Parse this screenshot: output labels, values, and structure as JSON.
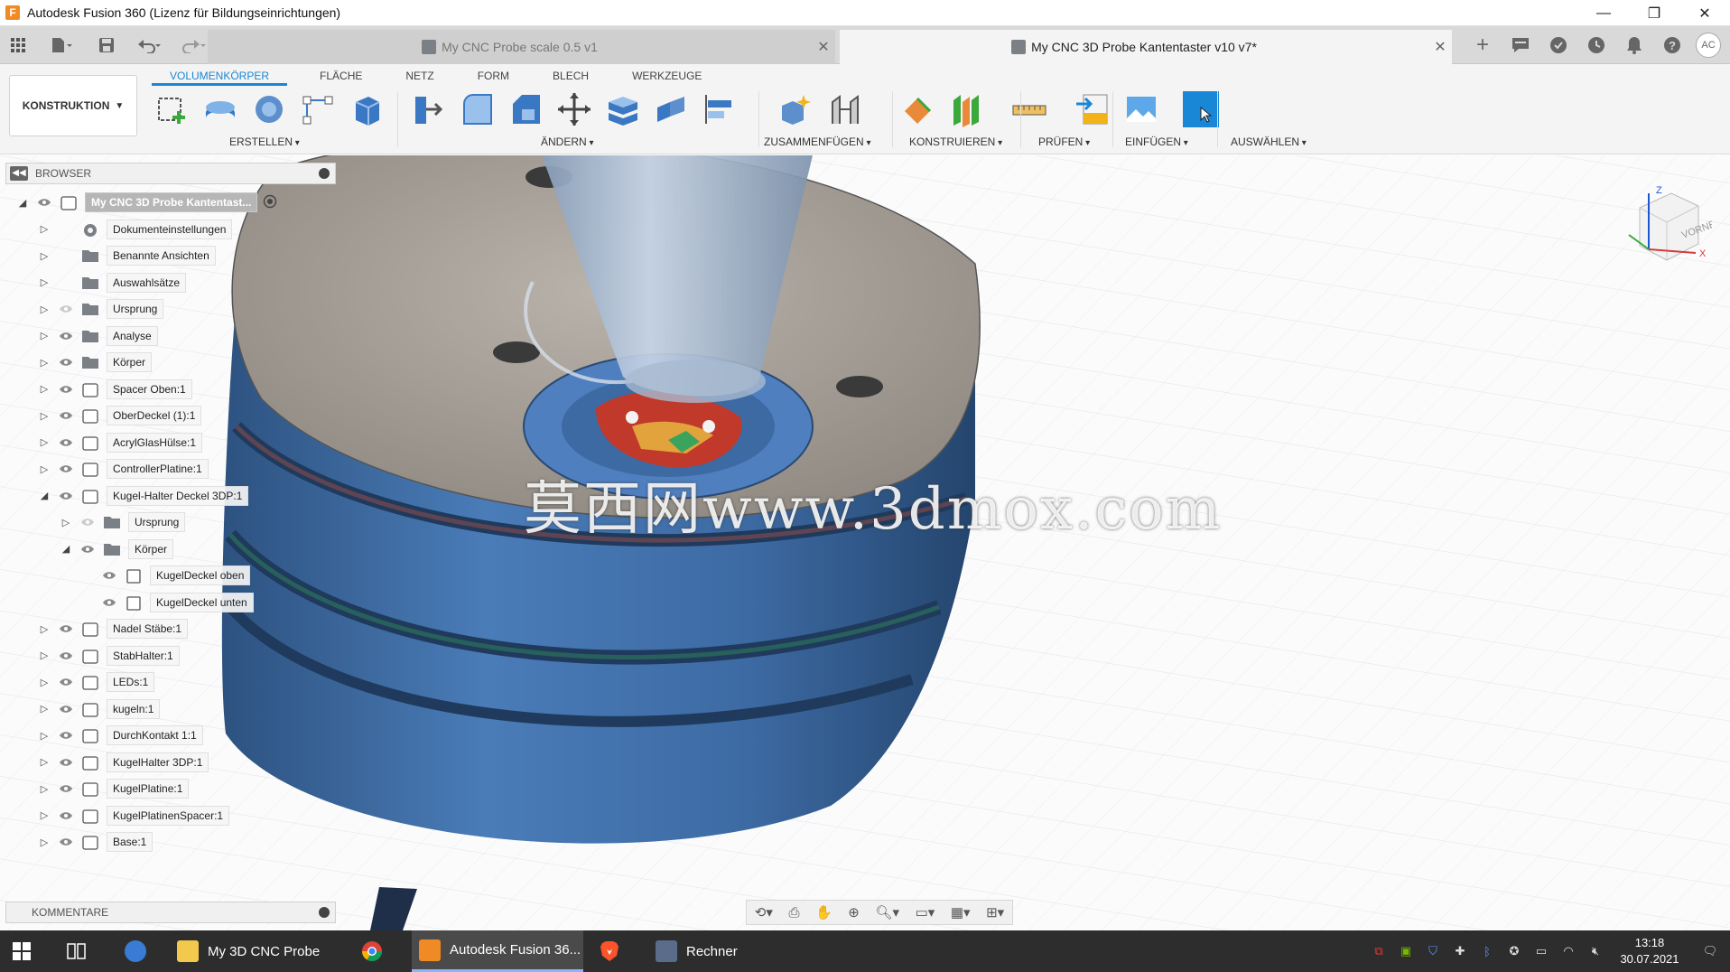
{
  "window": {
    "title": "Autodesk Fusion 360 (Lizenz für Bildungseinrichtungen)",
    "minimize": "—",
    "maximize": "❐",
    "close": "✕"
  },
  "tabs": [
    {
      "label": "My CNC Probe scale 0.5 v1",
      "close": "✕"
    },
    {
      "label": "My CNC 3D Probe Kantentaster v10 v7*",
      "close": "✕"
    }
  ],
  "header_icons": {
    "add": "+",
    "avatar": "AC"
  },
  "ribbon": {
    "workspace": "KONSTRUKTION",
    "tabs": [
      "VOLUMENKÖRPER",
      "FLÄCHE",
      "NETZ",
      "FORM",
      "BLECH",
      "WERKZEUGE"
    ],
    "groups": [
      "ERSTELLEN",
      "ÄNDERN",
      "ZUSAMMENFÜGEN",
      "KONSTRUIEREN",
      "PRÜFEN",
      "EINFÜGEN",
      "AUSWÄHLEN"
    ]
  },
  "browser": {
    "title": "BROWSER",
    "items": [
      {
        "label": "My CNC 3D Probe Kantentast...",
        "expanded": true,
        "type": "root",
        "icon": "component-icon"
      },
      {
        "label": "Dokumenteinstellungen",
        "expanded": false,
        "type": "settings",
        "icon": "gear-icon"
      },
      {
        "label": "Benannte Ansichten",
        "expanded": false,
        "type": "folder",
        "icon": "folder-icon"
      },
      {
        "label": "Auswahlsätze",
        "expanded": false,
        "type": "folder",
        "icon": "folder-icon"
      },
      {
        "label": "Ursprung",
        "expanded": false,
        "type": "folder",
        "icon": "folder-icon"
      },
      {
        "label": "Analyse",
        "expanded": false,
        "type": "folder",
        "icon": "folder-icon"
      },
      {
        "label": "Körper",
        "expanded": false,
        "type": "folder",
        "icon": "folder-icon"
      },
      {
        "label": "Spacer Oben:1",
        "expanded": false,
        "type": "component",
        "icon": "component-icon"
      },
      {
        "label": "OberDeckel (1):1",
        "expanded": false,
        "type": "component",
        "icon": "component-icon"
      },
      {
        "label": "AcrylGlasHülse:1",
        "expanded": false,
        "type": "component",
        "icon": "component-icon"
      },
      {
        "label": "ControllerPlatine:1",
        "expanded": false,
        "type": "component",
        "icon": "component-icon"
      },
      {
        "label": "Kugel-Halter Deckel 3DP:1",
        "expanded": true,
        "type": "component",
        "icon": "component-icon"
      },
      {
        "label": "Ursprung",
        "expanded": false,
        "type": "folder",
        "icon": "folder-icon"
      },
      {
        "label": "Körper",
        "expanded": true,
        "type": "folder",
        "icon": "folder-icon"
      },
      {
        "label": "KugelDeckel oben",
        "expanded": null,
        "type": "body",
        "icon": "body-icon"
      },
      {
        "label": "KugelDeckel unten",
        "expanded": null,
        "type": "body",
        "icon": "body-icon"
      },
      {
        "label": "Nadel Stäbe:1",
        "expanded": false,
        "type": "component",
        "icon": "component-icon"
      },
      {
        "label": "StabHalter:1",
        "expanded": false,
        "type": "component",
        "icon": "component-icon"
      },
      {
        "label": "LEDs:1",
        "expanded": false,
        "type": "component",
        "icon": "component-icon"
      },
      {
        "label": "kugeln:1",
        "expanded": false,
        "type": "component",
        "icon": "component-icon"
      },
      {
        "label": "DurchKontakt 1:1",
        "expanded": false,
        "type": "component",
        "icon": "component-icon"
      },
      {
        "label": "KugelHalter 3DP:1",
        "expanded": false,
        "type": "component",
        "icon": "component-icon"
      },
      {
        "label": "KugelPlatine:1",
        "expanded": false,
        "type": "component",
        "icon": "component-icon"
      },
      {
        "label": "KugelPlatinenSpacer:1",
        "expanded": false,
        "type": "component",
        "icon": "component-icon"
      },
      {
        "label": "Base:1",
        "expanded": false,
        "type": "component",
        "icon": "component-icon"
      }
    ]
  },
  "comments": {
    "title": "KOMMENTARE"
  },
  "viewcube": {
    "face": "VORNE",
    "axis_z": "Z",
    "axis_x": "X"
  },
  "watermark": "莫西网www.3dmox.com",
  "taskbar": {
    "items": [
      {
        "label": "My 3D CNC Probe",
        "icon": "folder-icon"
      },
      {
        "label": "Autodesk Fusion 36...",
        "icon": "fusion-icon"
      },
      {
        "label": "Rechner",
        "icon": "calculator-icon"
      }
    ],
    "time": "13:18",
    "date": "30.07.2021"
  },
  "colors": {
    "accent": "#1a86d6",
    "body_blue": "#3f6fa8",
    "body_gray": "#9a9590",
    "taskbar": "#2d2d2d"
  }
}
